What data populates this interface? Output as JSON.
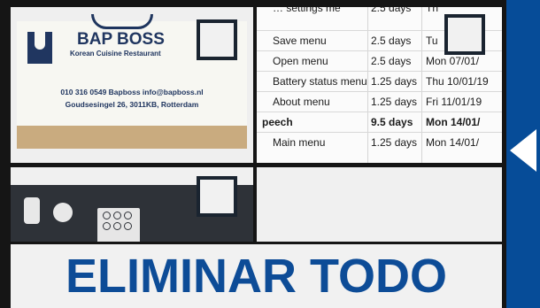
{
  "gallery": {
    "card": {
      "brand": "BAP BOSS",
      "subtitle": "Korean Cuisine Restaurant",
      "contact": "010 316 0549  Bapboss  info@bapboss.nl",
      "address": "Goudsesingel 26, 3011KB, Rotterdam"
    },
    "table": {
      "partial_row": [
        "… settings me",
        "2.5 days",
        "Th"
      ],
      "rows": [
        {
          "task": "Save menu",
          "duration": "2.5 days",
          "date": "Tu"
        },
        {
          "task": "Open menu",
          "duration": "2.5 days",
          "date": "Mon 07/01/"
        },
        {
          "task": "Battery status menu",
          "duration": "1.25 days",
          "date": "Thu 10/01/19"
        },
        {
          "task": "About menu",
          "duration": "1.25 days",
          "date": "Fri 11/01/19"
        },
        {
          "task": "peech",
          "duration": "9.5 days",
          "date": "Mon 14/01/"
        },
        {
          "task": "Main menu",
          "duration": "1.25 days",
          "date": "Mon 14/01/"
        }
      ]
    }
  },
  "actions": {
    "delete_all_label": "ELIMINAR TODO"
  },
  "colors": {
    "accent": "#064c98",
    "label": "#0d4c97",
    "background": "#151515"
  },
  "icons": {
    "back": "chevron-left-icon",
    "select": "checkbox-icon"
  }
}
